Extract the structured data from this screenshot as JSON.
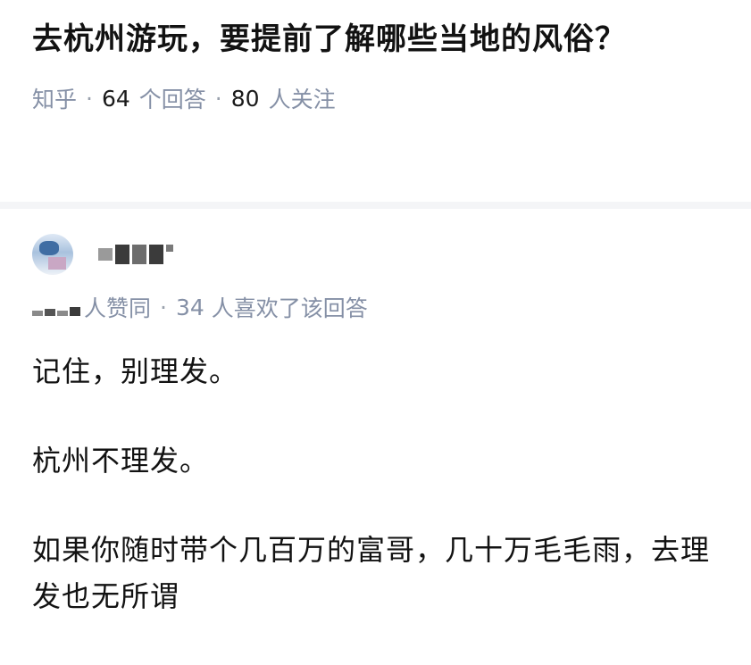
{
  "question": {
    "title": "去杭州游玩，要提前了解哪些当地的风俗？",
    "source": "知乎",
    "answer_count": "64",
    "answer_unit": "个回答",
    "follower_count": "80",
    "follower_unit": "人关注",
    "separator": "·"
  },
  "answer": {
    "agree_suffix": "人赞同",
    "like_count": "34",
    "like_text": "人喜欢了该回答",
    "paragraphs": [
      "记住，别理发。",
      "杭州不理发。",
      "如果你随时带个几百万的富哥，几十万毛毛雨，去理发也无所谓"
    ]
  }
}
